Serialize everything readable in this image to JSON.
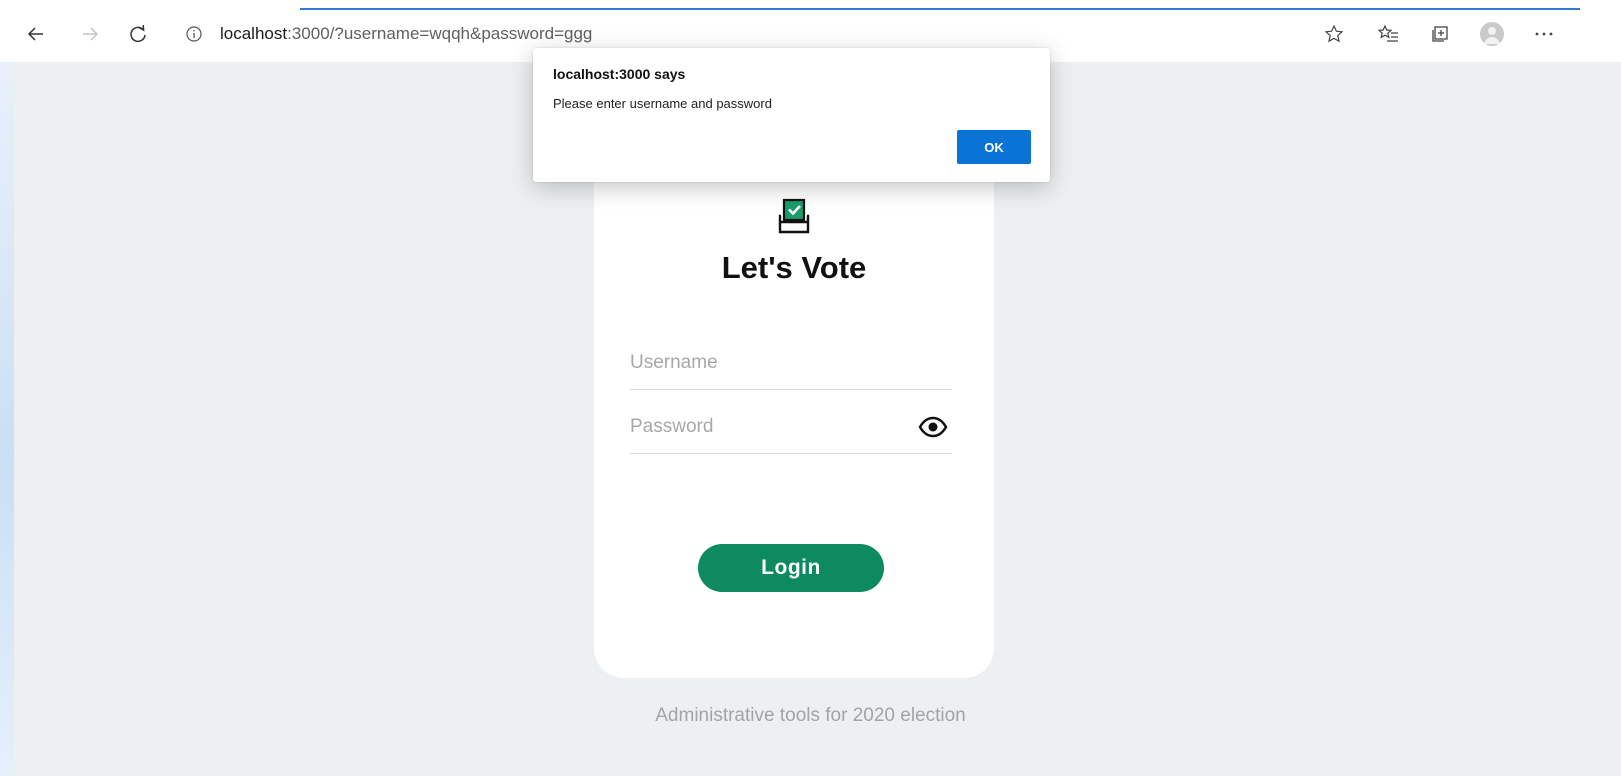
{
  "browser": {
    "url_host": "localhost",
    "url_rest": ":3000/?username=wqqh&password=ggg",
    "icons": [
      "back-arrow-icon",
      "forward-arrow-icon",
      "refresh-icon",
      "info-icon",
      "favorite-star-icon",
      "favorites-list-icon",
      "collections-icon",
      "profile-avatar-icon",
      "more-dots-icon"
    ],
    "accent_color": "#2b7cd3"
  },
  "dialog": {
    "title": "localhost:3000 says",
    "message": "Please enter username and password",
    "ok_label": "OK",
    "ok_color": "#0a74d6"
  },
  "login": {
    "logo_icon": "ballot-box-icon",
    "title": "Let's Vote",
    "username_placeholder": "Username",
    "password_placeholder": "Password",
    "password_toggle_icon": "eye-icon",
    "button_label": "Login",
    "button_color": "#0d8a5f"
  },
  "footer": {
    "text": "Administrative tools for 2020 election"
  }
}
